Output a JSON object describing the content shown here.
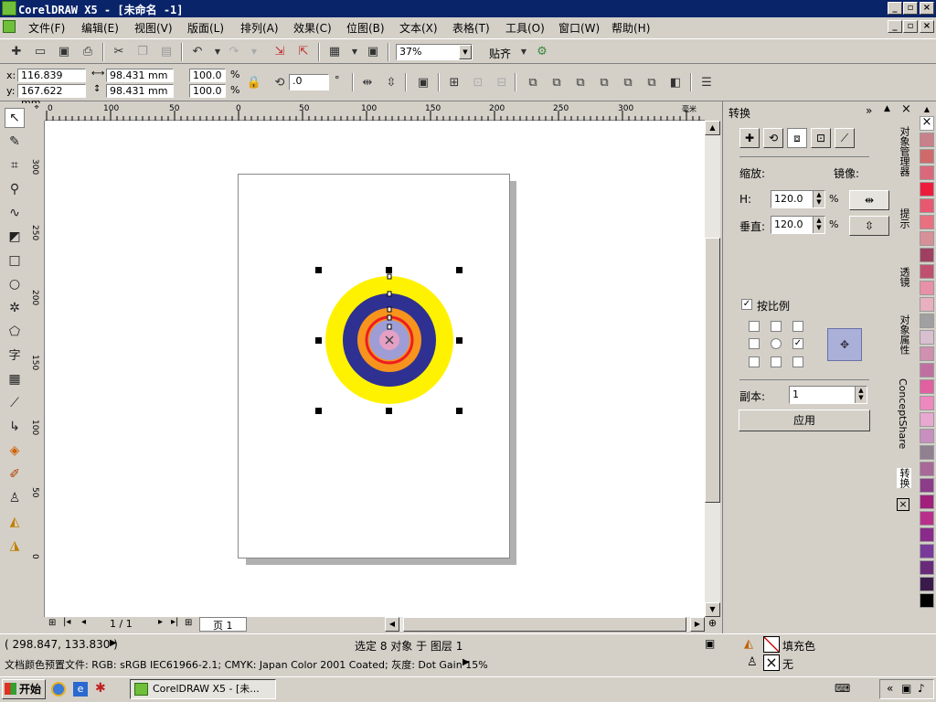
{
  "window": {
    "title": "CorelDRAW X5 - [未命名 -1]"
  },
  "menu": [
    "文件(F)",
    "编辑(E)",
    "视图(V)",
    "版面(L)",
    "排列(A)",
    "效果(C)",
    "位图(B)",
    "文本(X)",
    "表格(T)",
    "工具(O)",
    "窗口(W)",
    "帮助(H)"
  ],
  "standard_toolbar": {
    "zoom": "37%",
    "snap_label": "贴齐"
  },
  "property_bar": {
    "x": "116.839 mm",
    "y": "167.622 mm",
    "width": "98.431 mm",
    "height": "98.431 mm",
    "scale_x": "100.0",
    "scale_y": "100.0",
    "percent": "%",
    "angle": ".0",
    "degree": "°"
  },
  "ruler": {
    "h_ticks": [
      "0",
      "100",
      "50",
      "0",
      "50",
      "100",
      "150",
      "200",
      "250",
      "300"
    ],
    "h_unit": "毫米",
    "v_ticks": [
      "300",
      "250",
      "200",
      "150",
      "100",
      "50",
      "0"
    ]
  },
  "page_nav": {
    "counter": "1 / 1",
    "tab": "页 1"
  },
  "docker": {
    "title": "转换",
    "scale_label": "缩放:",
    "mirror_label": "镜像:",
    "h_label": "H:",
    "h_value": "120.0",
    "v_label": "垂直:",
    "v_value": "120.0",
    "percent": "%",
    "proportional_label": "按比例",
    "copies_label": "副本:",
    "copies_value": "1",
    "apply_label": "应用"
  },
  "docker_tabs": [
    "对象管理器",
    "提示",
    "透镜",
    "对象属性",
    "ConceptShare",
    "转换"
  ],
  "status": {
    "coords": "( 298.847, 133.830 )",
    "selection": "选定 8 对象 于 图层 1",
    "color_profile": "文档颜色预置文件: RGB: sRGB IEC61966-2.1; CMYK: Japan Color 2001 Coated; 灰度: Dot Gain 15%",
    "fill_label": "填充色",
    "outline_label": "无"
  },
  "taskbar": {
    "start": "开始",
    "task": "CorelDRAW X5 - [未..."
  },
  "colors": {
    "yellow": "#fff200",
    "navy": "#2e3192",
    "orange": "#f7941d",
    "red": "#ed1c24",
    "lavender": "#9e9dd6",
    "pink": "#e4a0c4"
  },
  "palette": [
    "#ffffff",
    "#c8808a",
    "#d06a6a",
    "#d9697a",
    "#ee1c3c",
    "#e85870",
    "#e87080",
    "#d89098",
    "#a04060",
    "#c05070",
    "#e890a8",
    "#e8b0c0",
    "#a0a0a0",
    "#d8c0d0",
    "#d090b0",
    "#c070a0",
    "#e060a0",
    "#f088c0",
    "#e8a8d0",
    "#c890c0",
    "#908090",
    "#a86898",
    "#8c3c88",
    "#a0207c",
    "#b8308c",
    "#8a2a8a",
    "#7a3a9a",
    "#6a2a7a",
    "#3a1a4a",
    "#000000"
  ]
}
